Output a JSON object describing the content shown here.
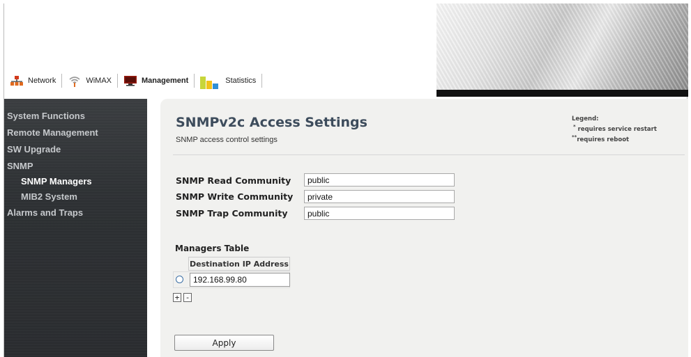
{
  "tabs": [
    {
      "id": "network",
      "label": "Network",
      "icon": "network-icon",
      "active": false
    },
    {
      "id": "wimax",
      "label": "WiMAX",
      "icon": "wifi-signal-icon",
      "active": false
    },
    {
      "id": "management",
      "label": "Management",
      "icon": "monitor-icon",
      "active": true
    },
    {
      "id": "statistics",
      "label": "Statistics",
      "icon": "bar-chart-icon",
      "active": false
    }
  ],
  "sidebar": {
    "items": [
      {
        "label": "System Functions"
      },
      {
        "label": "Remote Management"
      },
      {
        "label": "SW Upgrade"
      },
      {
        "label": "SNMP"
      },
      {
        "label": "SNMP Managers",
        "active": true
      },
      {
        "label": "MIB2 System"
      },
      {
        "label": "Alarms and Traps"
      }
    ]
  },
  "page": {
    "title": "SNMPv2c Access Settings",
    "subtitle": "SNMP access control settings"
  },
  "legend": {
    "title": "Legend:",
    "restart_mark": "*",
    "restart_text": "requires service restart",
    "reboot_mark": "**",
    "reboot_text": "requires reboot"
  },
  "form": {
    "read_label": "SNMP Read Community",
    "read_value": "public",
    "write_label": "SNMP Write Community",
    "write_value": "private",
    "trap_label": "SNMP Trap Community",
    "trap_value": "public"
  },
  "managers": {
    "title": "Managers Table",
    "column_header": "Destination IP Address",
    "rows": [
      {
        "ip": "192.168.99.80"
      }
    ],
    "add_label": "+",
    "remove_label": "-"
  },
  "actions": {
    "apply_label": "Apply"
  },
  "colors": {
    "sidebar_bg": "#2d3033",
    "content_bg": "#f1f1ef",
    "title_color": "#3d4c5c"
  }
}
